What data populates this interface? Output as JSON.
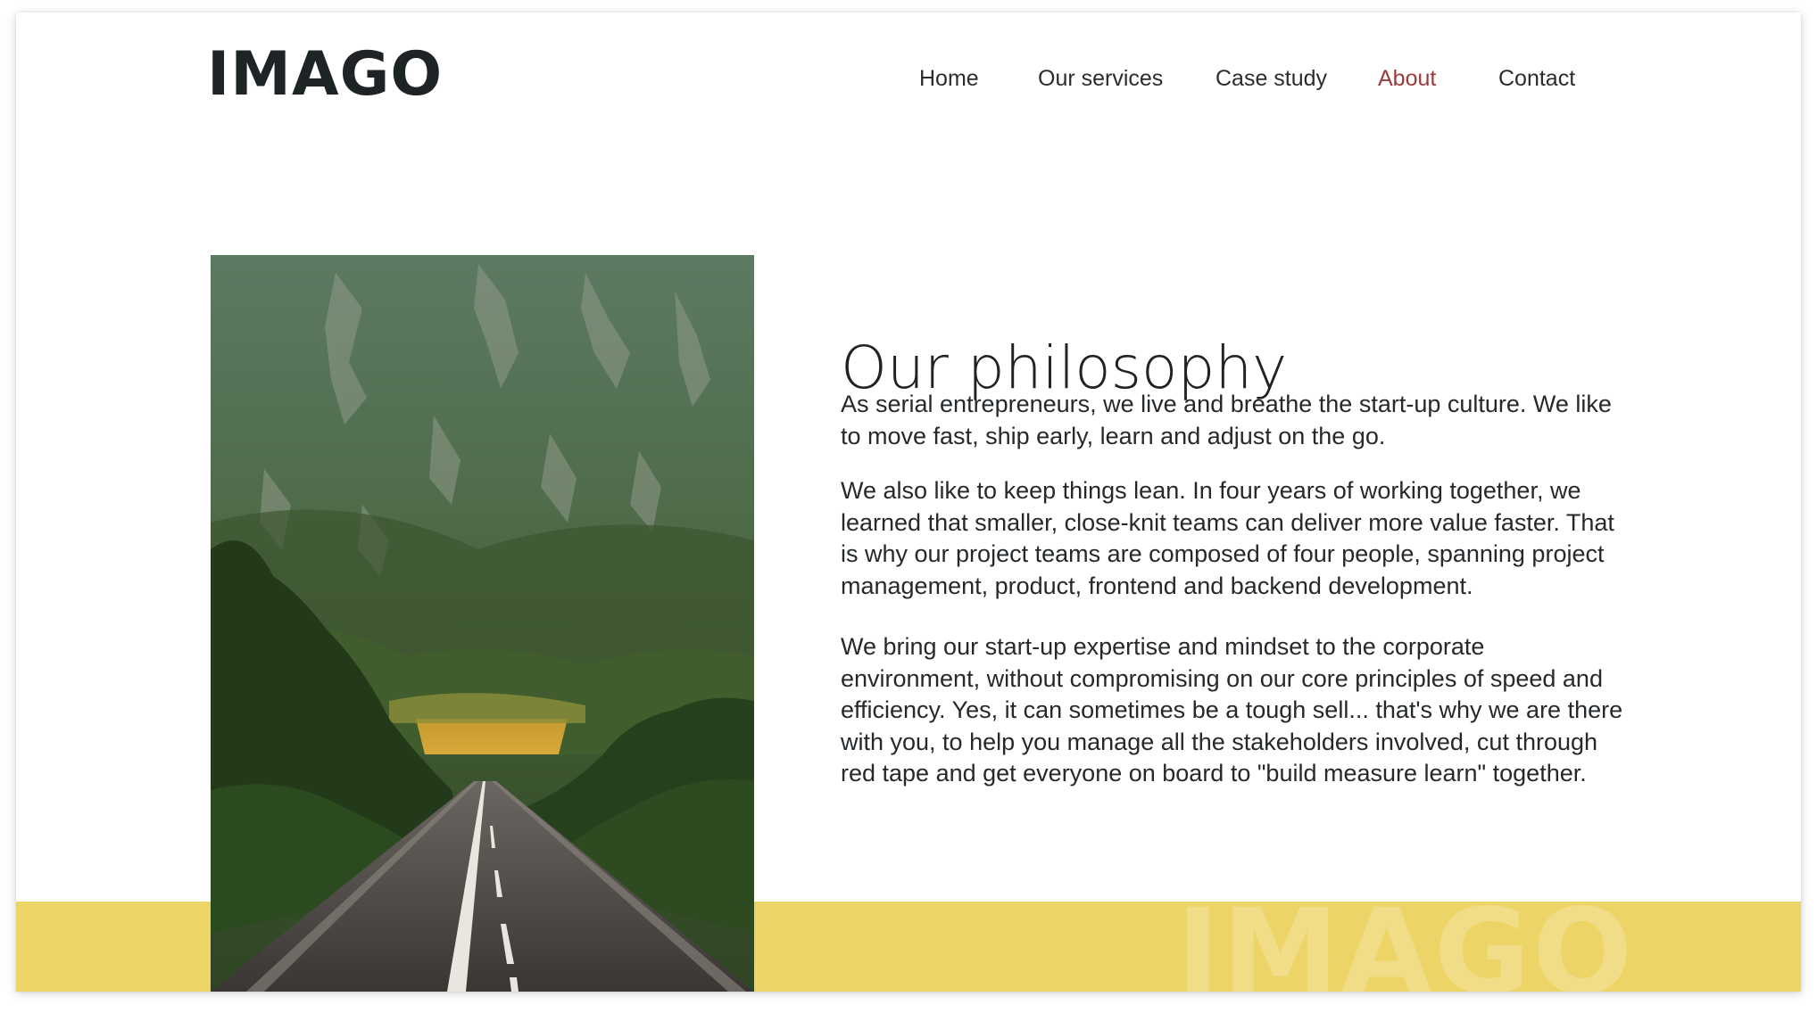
{
  "header": {
    "logo": "IMAGO"
  },
  "nav": {
    "items": [
      {
        "label": "Home",
        "active": false
      },
      {
        "label": "Our services",
        "active": false
      },
      {
        "label": "Case study",
        "active": false
      },
      {
        "label": "About",
        "active": true
      },
      {
        "label": "Contact",
        "active": false
      }
    ],
    "active_color": "#9c3a3a"
  },
  "main": {
    "heading": "Our philosophy",
    "paragraphs": [
      "As serial entrepreneurs, we live and breathe the start-up culture. We like to move fast, ship early, learn and adjust on the go.",
      "We also like to keep things lean. In four years of working together, we learned that smaller, close-knit teams can deliver more value faster. That is why our project teams are composed of four people, spanning project management, product, frontend and backend development.",
      "We bring our start-up expertise and mindset to the corporate environment, without compromising on our core principles of speed and efficiency. Yes, it can sometimes be a tough sell... that's why we are there with you, to help you manage all the stakeholders involved, cut through red tape and get everyone on board to \"build measure learn\" together."
    ]
  },
  "footer": {
    "watermark": "IMAGO",
    "band_color": "#edd466"
  }
}
